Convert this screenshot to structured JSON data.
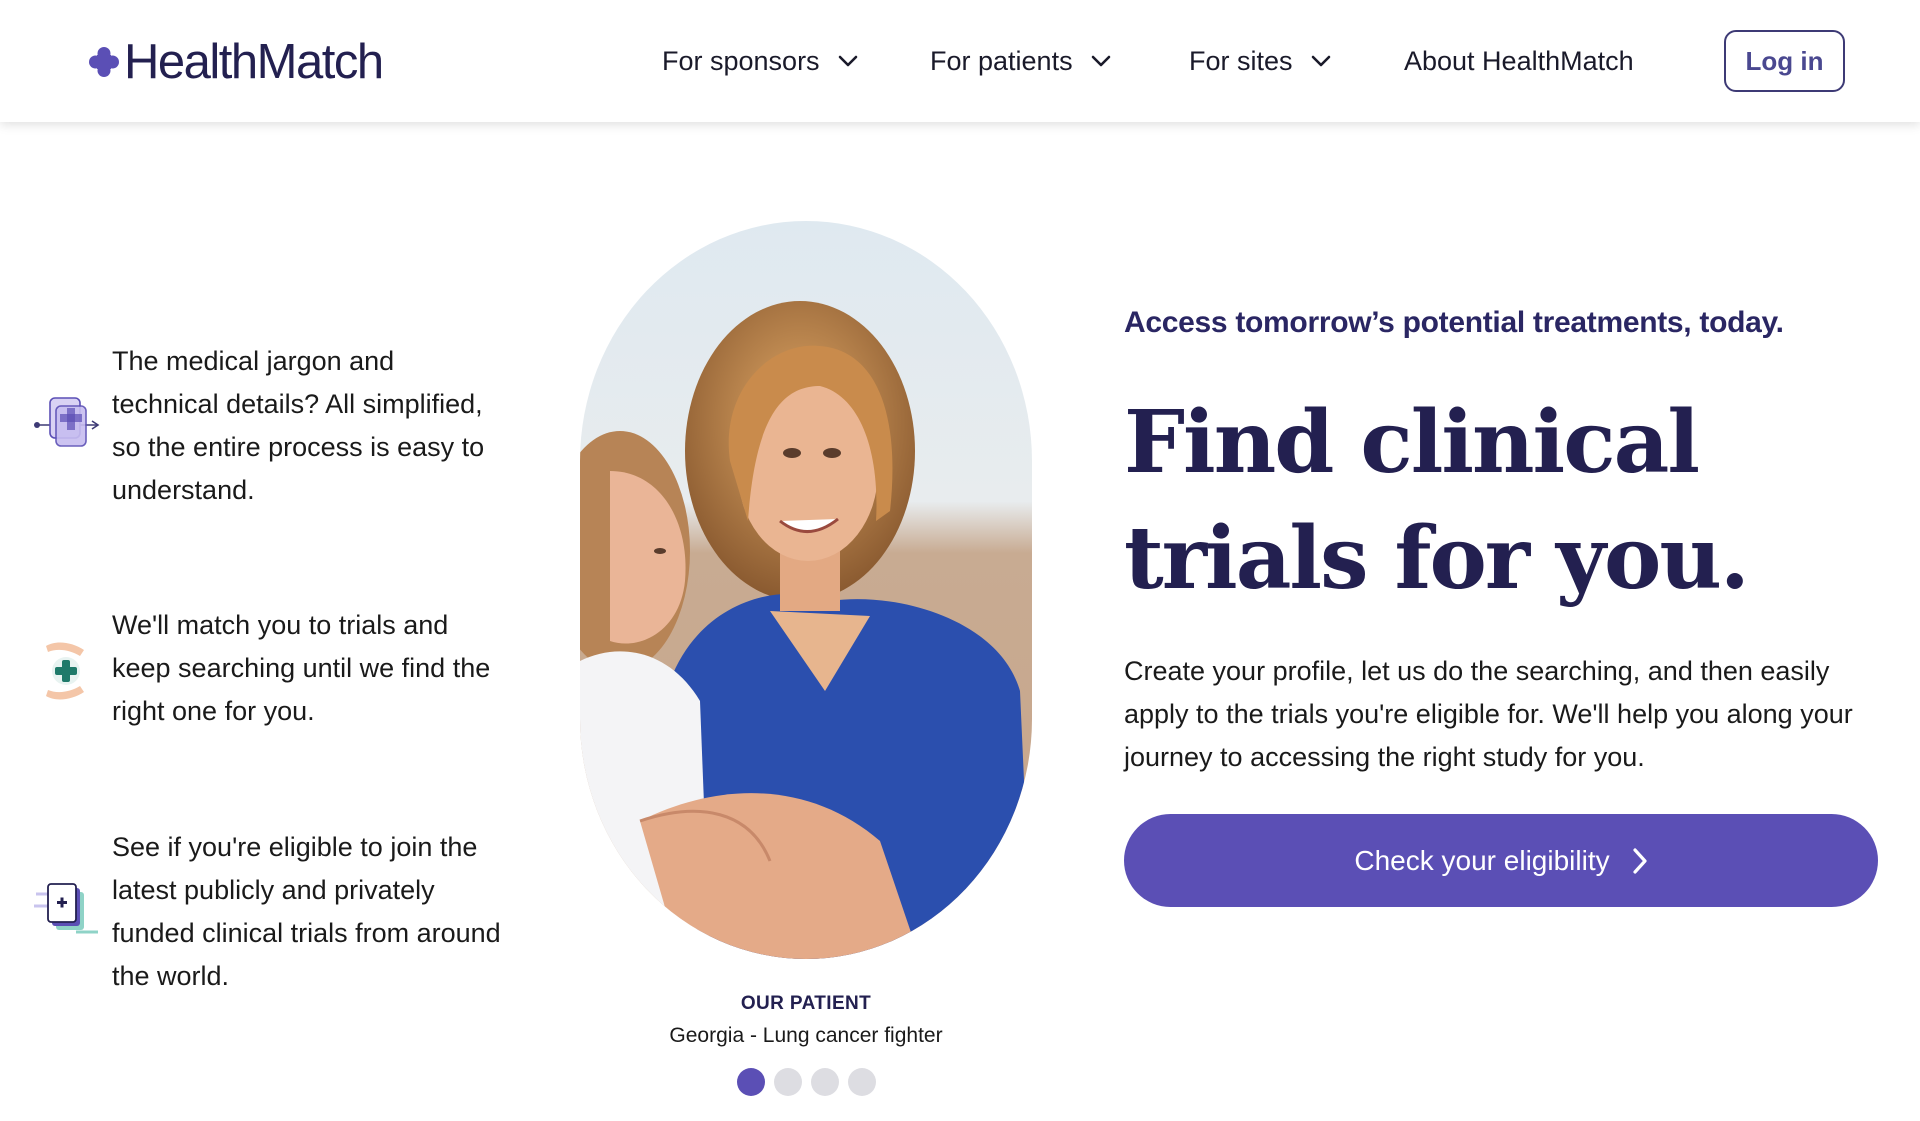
{
  "brand": {
    "name": "HealthMatch",
    "logo_icon": "plus-cross-icon",
    "color_primary": "#5b4fb5",
    "color_dark": "#232050"
  },
  "nav": {
    "items": [
      {
        "label": "For sponsors",
        "has_dropdown": true
      },
      {
        "label": "For patients",
        "has_dropdown": true
      },
      {
        "label": "For sites",
        "has_dropdown": true
      },
      {
        "label": "About HealthMatch",
        "has_dropdown": false
      }
    ],
    "login_label": "Log in"
  },
  "features": [
    {
      "icon": "documents-simplify-icon",
      "text": "The medical jargon and technical details? All simplified, so the entire process is easy to understand."
    },
    {
      "icon": "hands-cross-icon",
      "text": "We'll match you to trials and keep searching until we find the right one for you."
    },
    {
      "icon": "eligibility-card-icon",
      "text": "See if you're eligible to join the latest publicly and privately funded clinical trials from around the world."
    }
  ],
  "patient": {
    "label": "OUR PATIENT",
    "name": "Georgia - Lung cancer fighter",
    "slide_count": 4,
    "active_slide": 1
  },
  "hero": {
    "eyebrow": "Access tomorrow’s potential treatments, today.",
    "headline": "Find clinical trials for you.",
    "body": "Create your profile, let us do the searching, and then easily apply to the trials you're eligible for. We'll help you along your journey to accessing the right study for you.",
    "cta_label": "Check your eligibility",
    "cta_icon": "chevron-right-icon"
  }
}
